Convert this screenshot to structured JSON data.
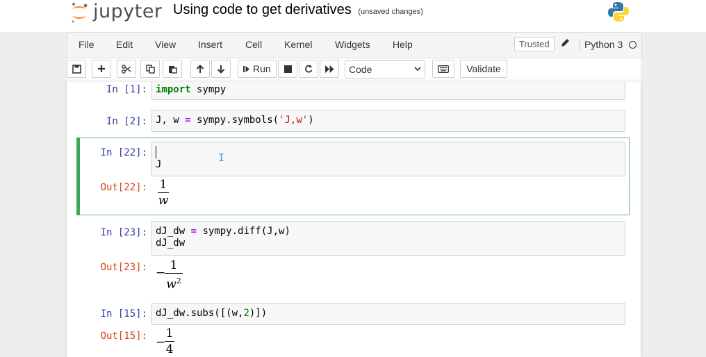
{
  "header": {
    "app_name": "jupyter",
    "notebook_title": "Using code to get derivatives",
    "autosave_status": "(unsaved changes)",
    "logo_icon": "jupyter-logo-icon",
    "kernel_logo_icon": "python-logo-icon"
  },
  "menubar": {
    "items": [
      "File",
      "Edit",
      "View",
      "Insert",
      "Cell",
      "Kernel",
      "Widgets",
      "Help"
    ],
    "trusted_label": "Trusted",
    "kernel_name": "Python 3"
  },
  "toolbar": {
    "run_label": "Run",
    "cell_type_value": "Code",
    "validate_label": "Validate"
  },
  "cells": [
    {
      "in_prompt": "In [1]:",
      "code": "import sympy"
    },
    {
      "in_prompt": "In [2]:",
      "code": "J, w = sympy.symbols('J,w')"
    },
    {
      "in_prompt": "In [22]:",
      "code": "J",
      "out_prompt": "Out[22]:",
      "out_num": "1",
      "out_den": "w"
    },
    {
      "in_prompt": "In [23]:",
      "code_line1": "dJ_dw = sympy.diff(J,w)",
      "code_line2": "dJ_dw",
      "out_prompt": "Out[23]:",
      "out_sign": "−",
      "out_num": "1",
      "out_den": "w",
      "out_den_exp": "2"
    },
    {
      "in_prompt": "In [15]:",
      "code": "dJ_dw.subs([(w,2)])",
      "out_prompt": "Out[15]:",
      "out_sign": "−",
      "out_num": "1",
      "out_den": "4"
    }
  ],
  "colors": {
    "in_prompt": "#303f9f",
    "out_prompt": "#d84315",
    "selected_border": "#66bb6a",
    "jupyter_orange": "#f37726"
  }
}
